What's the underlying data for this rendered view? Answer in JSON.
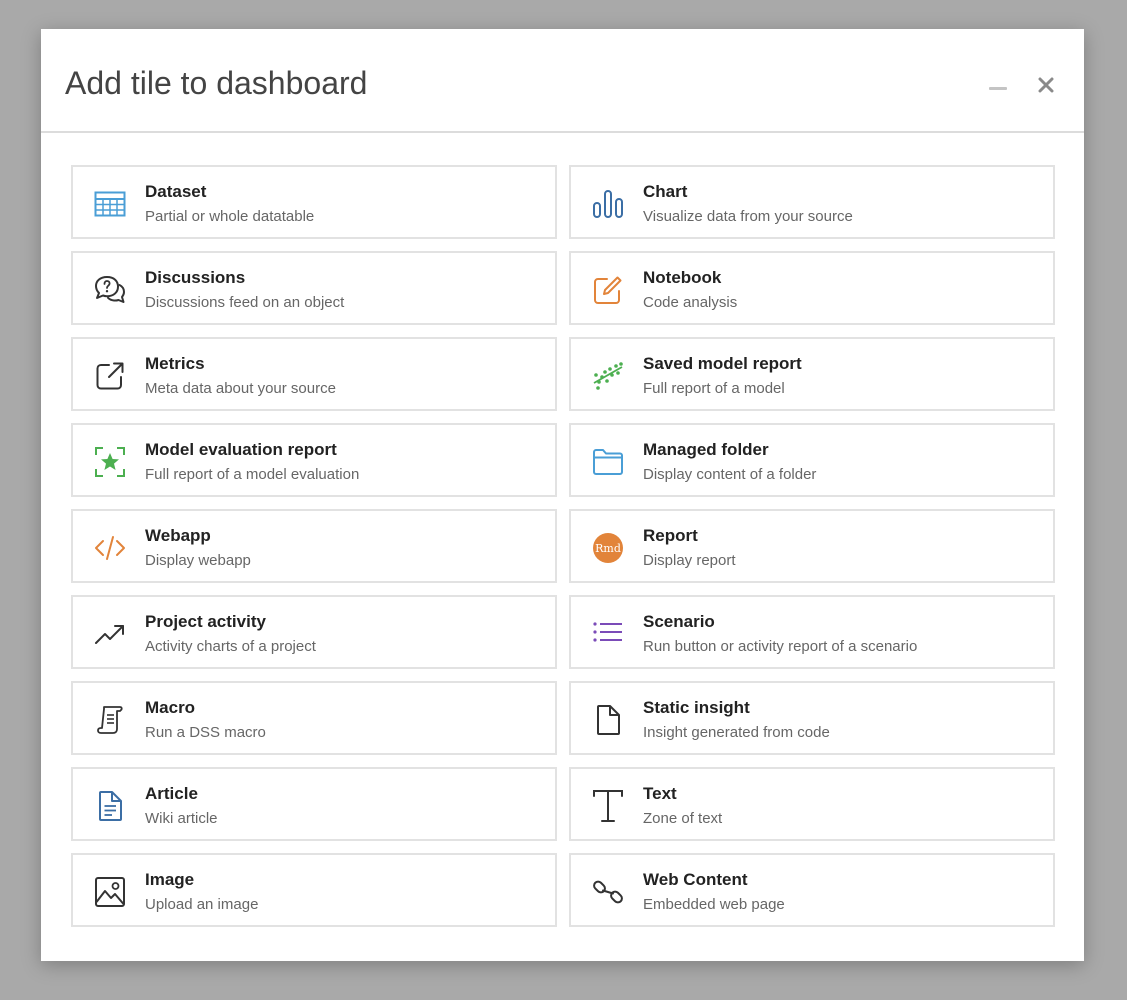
{
  "modal": {
    "title": "Add tile to dashboard",
    "minimize_icon": "minimize-icon",
    "close_icon": "close-icon"
  },
  "colors": {
    "blue": "#4a9ed6",
    "dark_blue": "#3b6ea5",
    "orange": "#e2843a",
    "green": "#4caf50",
    "purple": "#7b4bb8",
    "dark": "#333333",
    "badge_text": "Rmd"
  },
  "tiles": [
    {
      "title": "Dataset",
      "desc": "Partial or whole datatable",
      "icon": "table-icon"
    },
    {
      "title": "Chart",
      "desc": "Visualize data from your source",
      "icon": "bar-chart-icon"
    },
    {
      "title": "Discussions",
      "desc": "Discussions feed on an object",
      "icon": "discussion-bubbles-icon"
    },
    {
      "title": "Notebook",
      "desc": "Code analysis",
      "icon": "notebook-edit-icon"
    },
    {
      "title": "Metrics",
      "desc": "Meta data about your source",
      "icon": "external-link-icon"
    },
    {
      "title": "Saved model report",
      "desc": "Full report of a model",
      "icon": "scatter-model-icon"
    },
    {
      "title": "Model evaluation report",
      "desc": "Full report of a model evaluation",
      "icon": "star-frame-icon"
    },
    {
      "title": "Managed folder",
      "desc": "Display content of a folder",
      "icon": "folder-icon"
    },
    {
      "title": "Webapp",
      "desc": "Display webapp",
      "icon": "code-icon"
    },
    {
      "title": "Report",
      "desc": "Display report",
      "icon": "rmd-report-icon",
      "badge": "Rmd"
    },
    {
      "title": "Project activity",
      "desc": "Activity charts of a project",
      "icon": "trending-up-icon"
    },
    {
      "title": "Scenario",
      "desc": "Run button or activity report of a scenario",
      "icon": "list-icon"
    },
    {
      "title": "Macro",
      "desc": "Run a DSS macro",
      "icon": "scroll-icon"
    },
    {
      "title": "Static insight",
      "desc": "Insight generated from code",
      "icon": "file-icon"
    },
    {
      "title": "Article",
      "desc": "Wiki article",
      "icon": "document-icon"
    },
    {
      "title": "Text",
      "desc": "Zone of text",
      "icon": "text-icon"
    },
    {
      "title": "Image",
      "desc": "Upload an image",
      "icon": "image-icon"
    },
    {
      "title": "Web Content",
      "desc": "Embedded web page",
      "icon": "link-icon"
    }
  ]
}
